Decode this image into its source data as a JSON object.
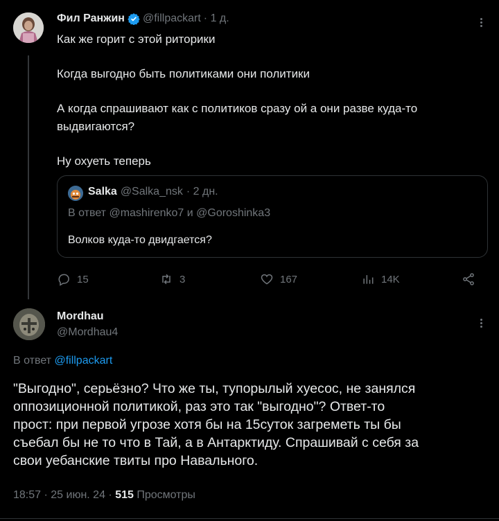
{
  "tweet": {
    "author_name": "Фил Ранжин",
    "handle": "@fillpackart",
    "time": "· 1 д.",
    "lines": [
      "Как же горит с этой риторики",
      "Когда выгодно быть политиками они политики",
      "А когда спрашивают как с политиков сразу ой а они разве куда-то",
      "выдвигаются?",
      "Ну охуеть теперь"
    ],
    "stats": {
      "replies": "15",
      "reposts": "3",
      "likes": "167",
      "views": "14K"
    }
  },
  "quote": {
    "author_name": "Salka",
    "handle": "@Salka_nsk",
    "time": "· 2 дн.",
    "reply_prefix": "В ответ ",
    "reply_user1": "@mashirenko7",
    "reply_and": " и ",
    "reply_user2": "@Goroshinka3",
    "text": "Волков куда-то двидгается?"
  },
  "reply": {
    "author_name": "Mordhau",
    "handle": "@Mordhau4",
    "reply_prefix": "В ответ ",
    "reply_to": "@fillpackart",
    "lines": [
      "\"Выгодно\", серьёзно? Что же ты, тупорылый хуесос, не занялся",
      "оппозиционной политикой, раз это так \"выгодно\"? Ответ-то",
      "прост: при первой угрозе хотя бы на 15суток загреметь ты бы",
      "съебал бы не то что в Тай, а в Антарктиду.  Спрашивай с себя за",
      "свои уебанские твиты про Навального."
    ],
    "meta_time": "18:57 · 25 июн. 24 · ",
    "meta_views_count": "515",
    "meta_views_label": " Просмотры"
  },
  "colors": {
    "accent": "#1d9bf0",
    "verified": "#1d9bf0",
    "muted": "#71767b",
    "text": "#e7e9ea"
  }
}
